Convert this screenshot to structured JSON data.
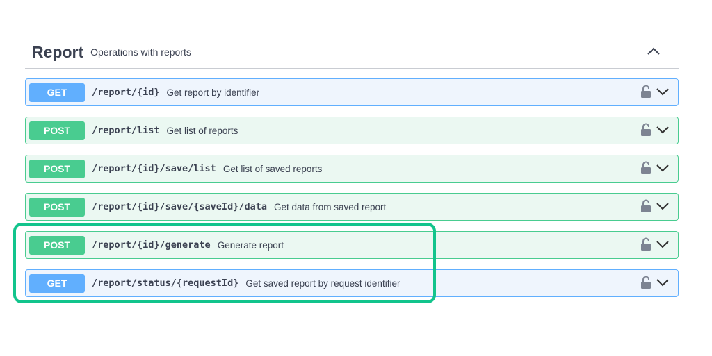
{
  "section": {
    "title": "Report",
    "description": "Operations with reports",
    "collapse_icon": "chevron-up-icon"
  },
  "operations": [
    {
      "method": "GET",
      "path": "/report/{id}",
      "summary": "Get report by identifier",
      "type": "get"
    },
    {
      "method": "POST",
      "path": "/report/list",
      "summary": "Get list of reports",
      "type": "post"
    },
    {
      "method": "POST",
      "path": "/report/{id}/save/list",
      "summary": "Get list of saved reports",
      "type": "post"
    },
    {
      "method": "POST",
      "path": "/report/{id}/save/{saveId}/data",
      "summary": "Get data from saved report",
      "type": "post"
    },
    {
      "method": "POST",
      "path": "/report/{id}/generate",
      "summary": "Generate report",
      "type": "post"
    },
    {
      "method": "GET",
      "path": "/report/status/{requestId}",
      "summary": "Get saved report by request identifier",
      "type": "get"
    }
  ],
  "icons": {
    "lock": "lock-icon",
    "expand": "chevron-down-icon"
  },
  "colors": {
    "get": "#61affe",
    "post": "#49cc90",
    "highlight": "#12c48c",
    "text": "#3b4151"
  }
}
